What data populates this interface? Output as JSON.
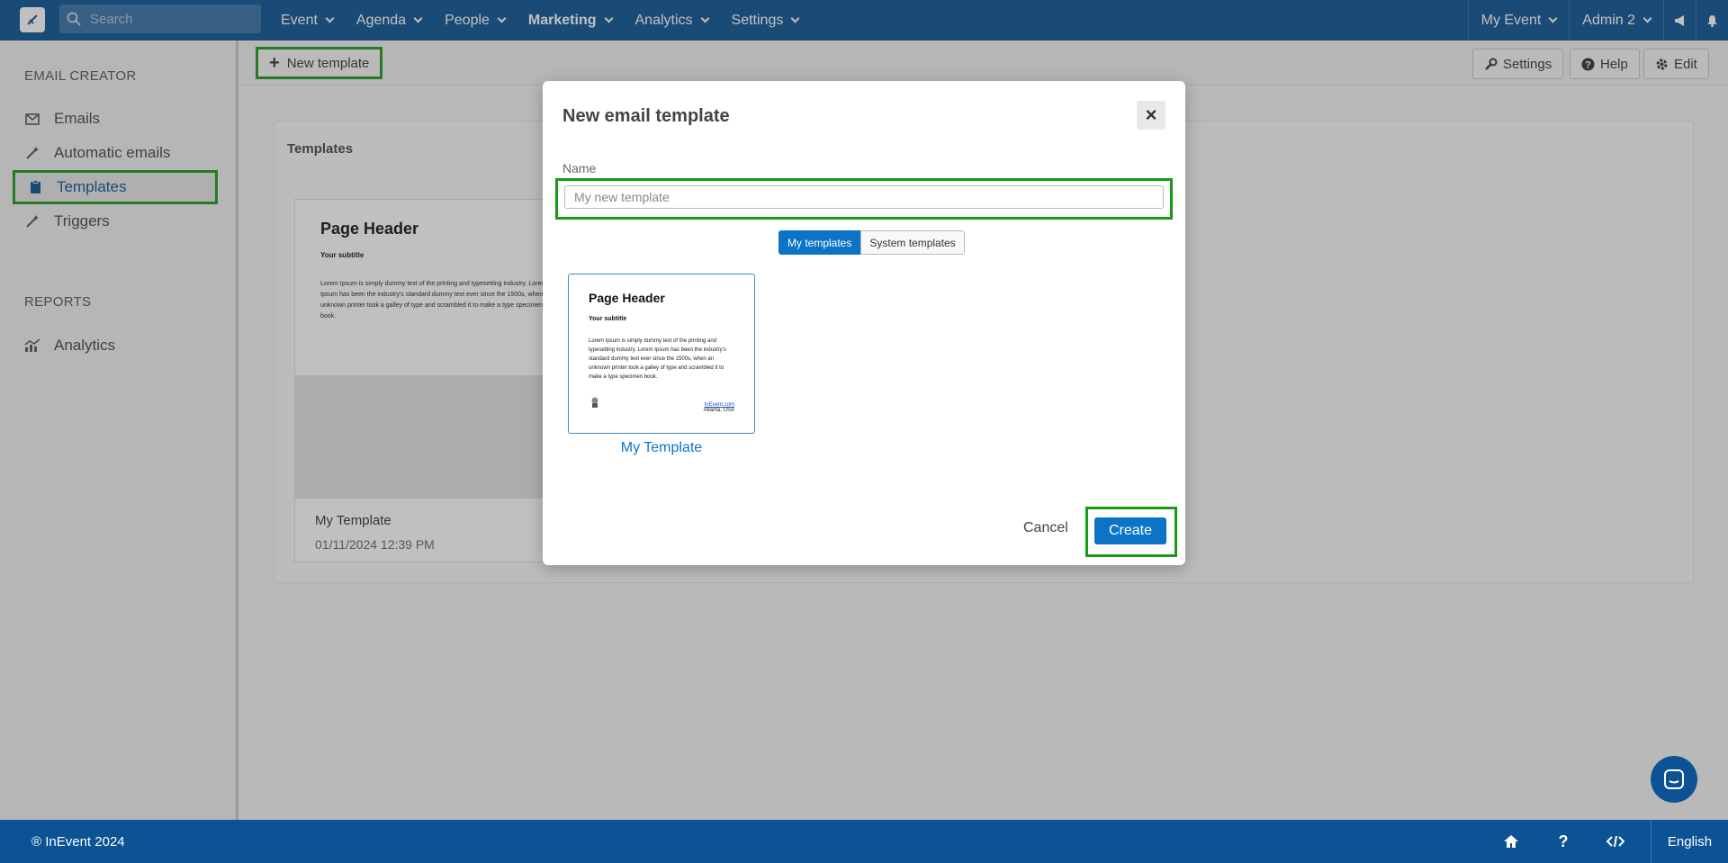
{
  "topbar": {
    "logo": "logo-icon",
    "search_placeholder": "Search",
    "nav": [
      {
        "label": "Event"
      },
      {
        "label": "Agenda"
      },
      {
        "label": "People"
      },
      {
        "label": "Marketing"
      },
      {
        "label": "Analytics"
      },
      {
        "label": "Settings"
      }
    ],
    "event_menu": "My Event",
    "user_menu": "Admin 2"
  },
  "sidebar": {
    "section1": "EMAIL CREATOR",
    "items": [
      {
        "label": "Emails",
        "icon": "envelope-icon"
      },
      {
        "label": "Automatic emails",
        "icon": "magic-wand-icon"
      },
      {
        "label": "Templates",
        "icon": "clipboard-icon"
      },
      {
        "label": "Triggers",
        "icon": "magic-wand-icon"
      }
    ],
    "section2": "REPORTS",
    "reports": [
      {
        "label": "Analytics",
        "icon": "chart-icon"
      }
    ]
  },
  "toolbar": {
    "new_template": "New template",
    "settings": "Settings",
    "help": "Help",
    "edit": "Edit"
  },
  "content": {
    "title": "Templates",
    "card": {
      "preview_header": "Page Header",
      "preview_subtitle": "Your subtitle",
      "preview_body": "Lorem Ipsum is simply dummy text of the printing and typesetting industry. Lorem Ipsum has been the industry's standard dummy text ever since the 1500s, when an unknown printer took a galley of type and scrambled it to make a type specimen book.",
      "name": "My Template",
      "date": "01/11/2024 12:39 PM"
    }
  },
  "modal": {
    "title": "New email template",
    "name_label": "Name",
    "name_placeholder": "My new template",
    "tab_mine": "My templates",
    "tab_system": "System templates",
    "template": {
      "header": "Page Header",
      "subtitle": "Your subtitle",
      "body": "Lorem Ipsum is simply dummy text of the printing and typesetting industry. Lorem Ipsum has been the industry's standard dummy text ever since the 1500s, when an unknown printer took a galley of type and scrambled it to make a type specimen book.",
      "link": "InEvent.com",
      "location": "Atlanta, USA",
      "name": "My Template"
    },
    "cancel": "Cancel",
    "create": "Create"
  },
  "footer": {
    "copyright": "® InEvent 2024",
    "language": "English"
  },
  "colors": {
    "brand": "#0b5394",
    "primary_button": "#0b74c7",
    "highlight": "#1a9a1a"
  }
}
